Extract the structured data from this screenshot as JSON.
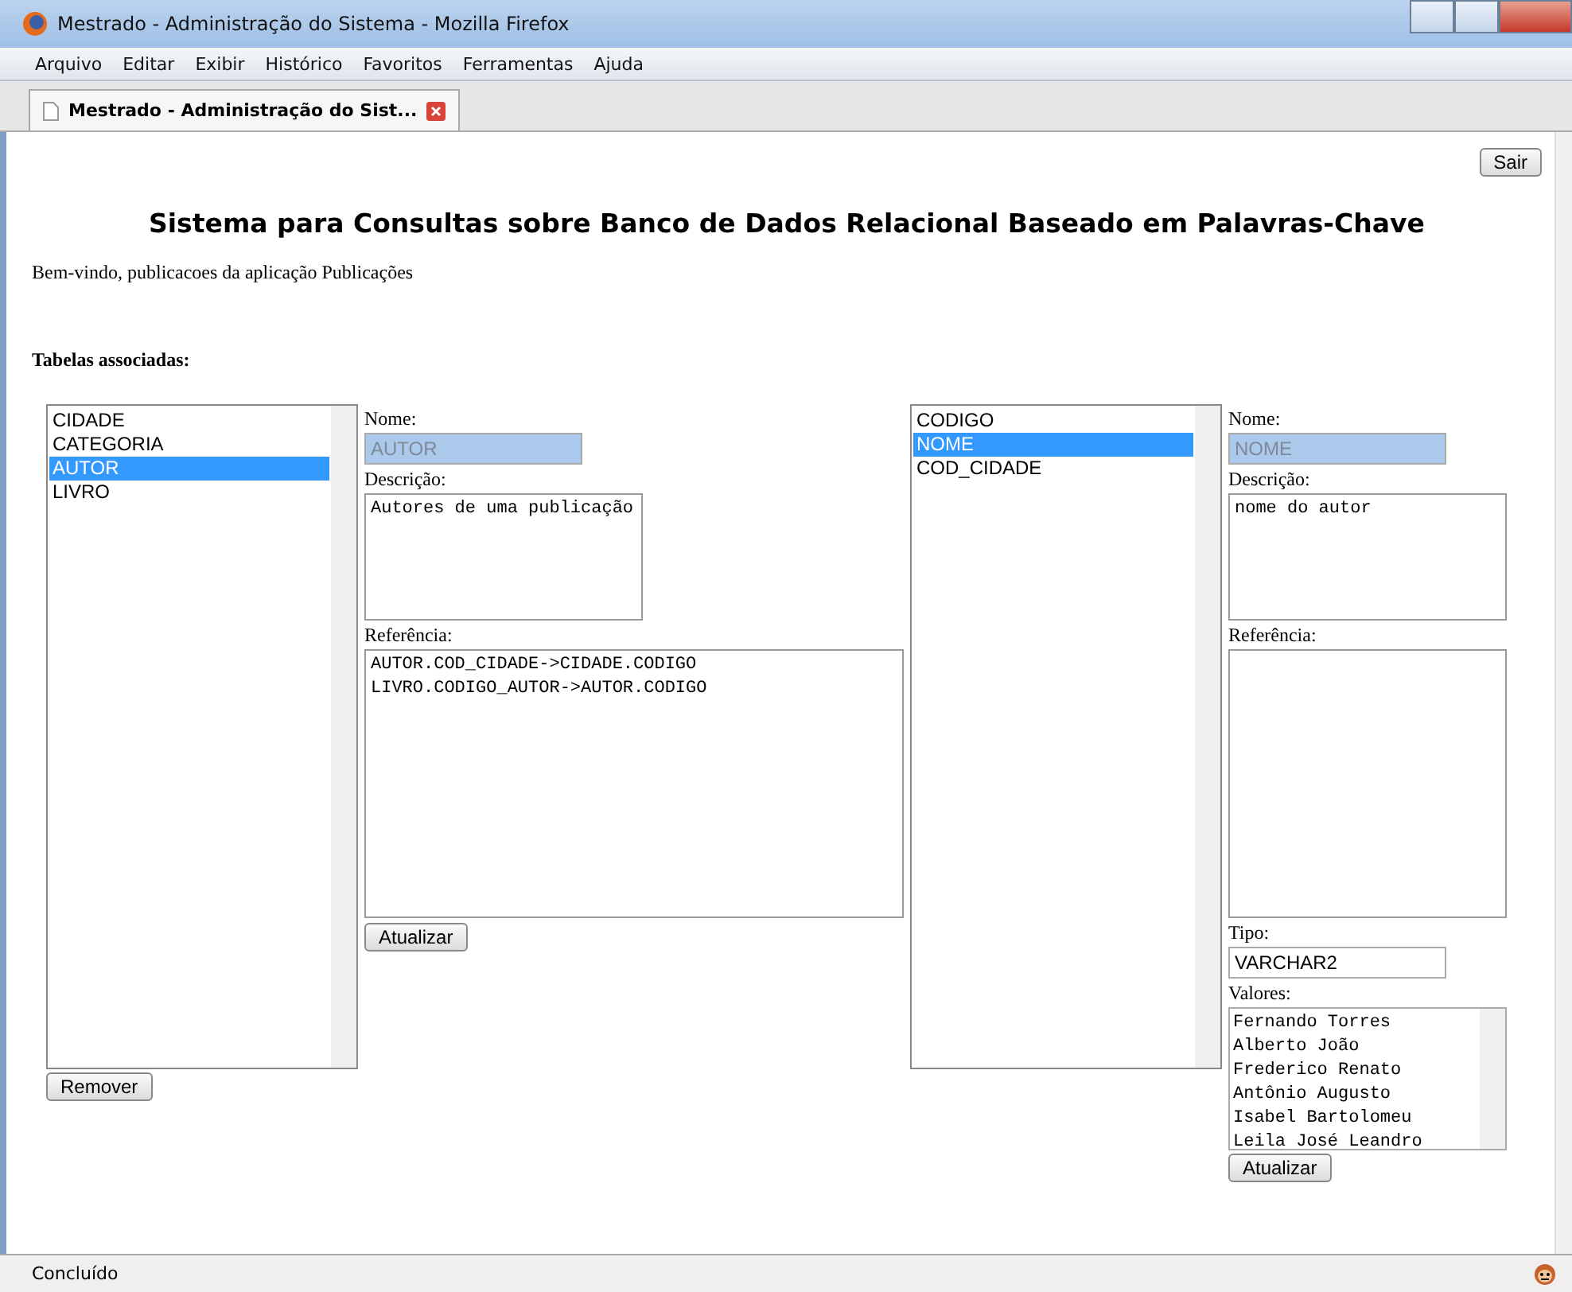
{
  "window": {
    "title": "Mestrado - Administração do Sistema - Mozilla Firefox"
  },
  "menu": [
    "Arquivo",
    "Editar",
    "Exibir",
    "Histórico",
    "Favoritos",
    "Ferramentas",
    "Ajuda"
  ],
  "tabs": [
    {
      "label": "Mestrado - Administração do Sist...",
      "selected": true
    }
  ],
  "page": {
    "logout_button": "Sair",
    "heading": "Sistema para Consultas sobre Banco de Dados Relacional Baseado em Palavras-Chave",
    "welcome": "Bem-vindo, publicacoes da aplicação Publicações",
    "section_title": "Tabelas associadas:"
  },
  "tables": {
    "items": [
      {
        "label": "CIDADE",
        "selected": false
      },
      {
        "label": "CATEGORIA",
        "selected": false
      },
      {
        "label": "AUTOR",
        "selected": true
      },
      {
        "label": "LIVRO",
        "selected": false
      }
    ],
    "remove_button": "Remover",
    "name_label": "Nome:",
    "name_value": "AUTOR",
    "description_label": "Descrição:",
    "description_value": "Autores de uma publicação",
    "reference_label": "Referência:",
    "references": [
      "AUTOR.COD_CIDADE->CIDADE.CODIGO",
      "LIVRO.CODIGO_AUTOR->AUTOR.CODIGO"
    ],
    "update_button": "Atualizar"
  },
  "columns": {
    "items": [
      {
        "label": "CODIGO",
        "selected": false
      },
      {
        "label": "NOME",
        "selected": true
      },
      {
        "label": "COD_CIDADE",
        "selected": false
      }
    ],
    "name_label": "Nome:",
    "name_value": "NOME",
    "description_label": "Descrição:",
    "description_value": "nome do autor",
    "reference_label": "Referência:",
    "type_label": "Tipo:",
    "type_value": "VARCHAR2",
    "values_label": "Valores:",
    "values": [
      "Fernando Torres",
      "Alberto João",
      "Frederico Renato",
      "Antônio Augusto",
      "Isabel Bartolomeu",
      "Leila José Leandro"
    ],
    "update_button": "Atualizar"
  },
  "status_bar": {
    "text": "Concluído"
  }
}
